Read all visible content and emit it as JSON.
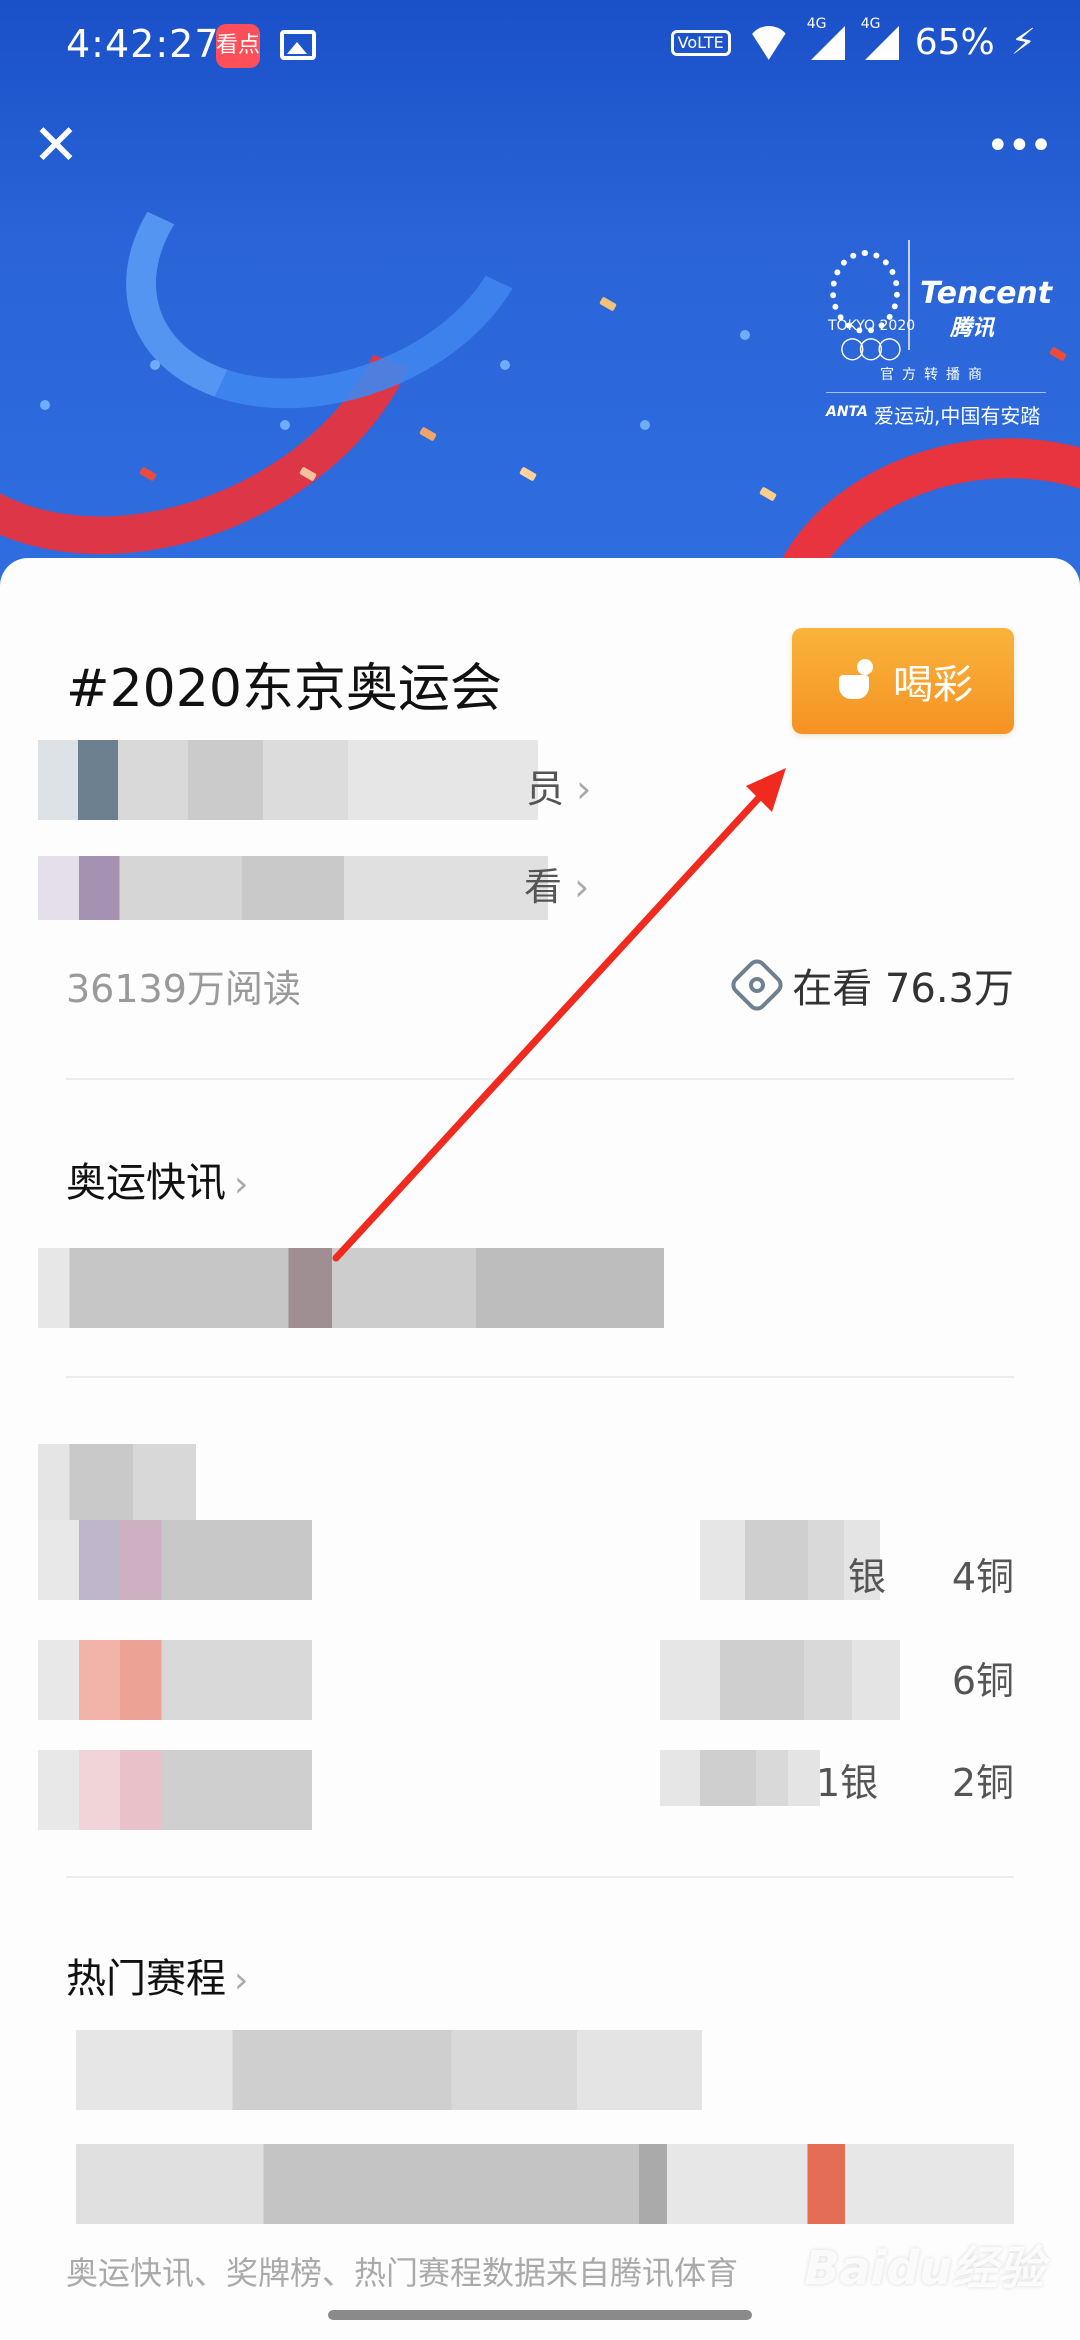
{
  "status_bar": {
    "time": "4:42:27",
    "app_badge": "看点",
    "volte": "VoLTE",
    "network1": "4G",
    "network2": "4G",
    "battery": "65%",
    "charging_icon": "bolt-icon"
  },
  "header": {
    "close_icon": "close-icon",
    "more_icon": "more-icon",
    "close_glyph": "✕",
    "more_glyph": "•••"
  },
  "banner": {
    "tokyo_text": "TOKYO 2020",
    "tencent_en": "Tencent",
    "tencent_cn": "腾讯",
    "official_text": "官方转播商",
    "anta_brand": "ANTA",
    "anta_slogan": "爱运动,中国有安踏"
  },
  "topic": {
    "title": "#2020东京奥运会",
    "cheer_label": "喝彩",
    "line1_suffix": "员",
    "line2_suffix": "看",
    "reads": "36139万阅读",
    "watching": "在看 76.3万"
  },
  "sections": {
    "news_title": "奥运快讯",
    "schedule_title": "热门赛程"
  },
  "medals": {
    "row1_right": "4铜",
    "row2_right": "6铜",
    "row3_silver": "1银",
    "row3_right": "2铜",
    "row1_partial": "银"
  },
  "footer": {
    "note": "奥运快讯、奖牌榜、热门赛程数据来自腾讯体育",
    "watermark": "Baidu经验"
  },
  "colors": {
    "accent_orange": "#f59223",
    "banner_blue": "#1a50c8",
    "arrow_red": "#f02a1e"
  }
}
